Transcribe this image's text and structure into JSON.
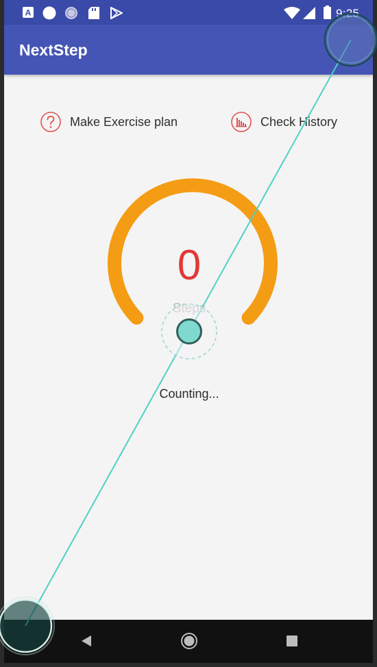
{
  "status_bar": {
    "time": "9:25",
    "left_icons": [
      "font-a-icon",
      "circle-icon",
      "sync-circle-icon",
      "sd-card-icon",
      "play-store-icon"
    ],
    "right_icons": [
      "wifi-icon",
      "signal-icon",
      "battery-icon"
    ]
  },
  "app_bar": {
    "title": "NextStep"
  },
  "actions": {
    "plan": {
      "label": "Make Exercise plan",
      "icon": "question-circle-icon"
    },
    "history": {
      "label": "Check History",
      "icon": "bar-chart-circle-icon"
    }
  },
  "counter": {
    "value": "0",
    "unit": "Steps",
    "status": "Counting..."
  },
  "nav_bar": {
    "buttons": [
      "back-icon",
      "home-icon",
      "recents-icon"
    ]
  },
  "colors": {
    "status_bar": "#3a4aa8",
    "app_bar": "#4455b5",
    "gauge": "#f49c14",
    "step_count": "#e23838",
    "action_icon": "#e05252",
    "touch_marker": "#7fd9cf",
    "gesture_line": "#4fd1c5"
  }
}
